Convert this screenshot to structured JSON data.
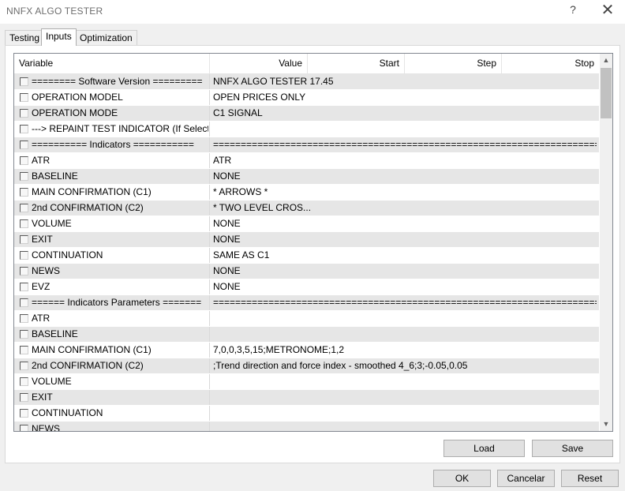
{
  "window": {
    "title": "NNFX ALGO TESTER",
    "help_glyph": "?",
    "close_glyph": "✕"
  },
  "tabs": [
    {
      "label": "Testing",
      "active": false
    },
    {
      "label": "Inputs",
      "active": true
    },
    {
      "label": "Optimization",
      "active": false
    }
  ],
  "table": {
    "headers": {
      "variable": "Variable",
      "value": "Value",
      "start": "Start",
      "step": "Step",
      "stop": "Stop"
    },
    "rows": [
      {
        "variable": "======== Software Version =========",
        "value": "NNFX ALGO TESTER 17.45"
      },
      {
        "variable": "OPERATION MODEL",
        "value": "OPEN PRICES ONLY"
      },
      {
        "variable": "OPERATION MODE",
        "value": "C1 SIGNAL"
      },
      {
        "variable": "---> REPAINT TEST INDICATOR (If Selected)",
        "value": ""
      },
      {
        "variable": "========== Indicators ===========",
        "value": "=========================================================================..."
      },
      {
        "variable": "ATR",
        "value": "ATR"
      },
      {
        "variable": "BASELINE",
        "value": "NONE"
      },
      {
        "variable": "MAIN CONFIRMATION (C1)",
        "value": "* ARROWS *"
      },
      {
        "variable": "2nd CONFIRMATION (C2)",
        "value": "* TWO LEVEL CROS..."
      },
      {
        "variable": "VOLUME",
        "value": "NONE"
      },
      {
        "variable": "EXIT",
        "value": "NONE"
      },
      {
        "variable": "CONTINUATION",
        "value": "SAME AS C1"
      },
      {
        "variable": "NEWS",
        "value": "NONE"
      },
      {
        "variable": "EVZ",
        "value": "NONE"
      },
      {
        "variable": "====== Indicators Parameters =======",
        "value": "=========================================================================..."
      },
      {
        "variable": "ATR",
        "value": ""
      },
      {
        "variable": "BASELINE",
        "value": ""
      },
      {
        "variable": "MAIN CONFIRMATION (C1)",
        "value": "7,0,0,3,5,15;METRONOME;1,2"
      },
      {
        "variable": "2nd CONFIRMATION (C2)",
        "value": ";Trend direction and force index - smoothed 4_6;3;-0.05,0.05"
      },
      {
        "variable": "VOLUME",
        "value": ""
      },
      {
        "variable": "EXIT",
        "value": ""
      },
      {
        "variable": "CONTINUATION",
        "value": ""
      },
      {
        "variable": "NEWS",
        "value": ""
      }
    ]
  },
  "scrollbar": {
    "up_glyph": "▲",
    "down_glyph": "▼"
  },
  "buttons": {
    "load": "Load",
    "save": "Save",
    "ok": "OK",
    "cancel": "Cancelar",
    "reset": "Reset"
  }
}
